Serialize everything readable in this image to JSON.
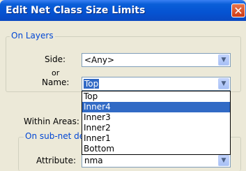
{
  "window": {
    "title": "Edit Net Class Size Limits",
    "close_symbol": "✕"
  },
  "on_layers": {
    "legend": "On Layers",
    "side_label": "Side:",
    "side_value": "<Any>",
    "or_label": "or",
    "name_label": "Name:",
    "name_value": "Top"
  },
  "within_areas_label": "Within Areas:",
  "sub_net": {
    "legend": "On sub-net de",
    "attribute_label": "Attribute:",
    "attribute_value": "nma"
  },
  "dropdown": {
    "options": [
      "Top",
      "Inner4",
      "Inner3",
      "Inner2",
      "Inner1",
      "Bottom"
    ],
    "highlighted": "Inner4"
  },
  "icons": {
    "dropdown_arrow": "▼"
  }
}
